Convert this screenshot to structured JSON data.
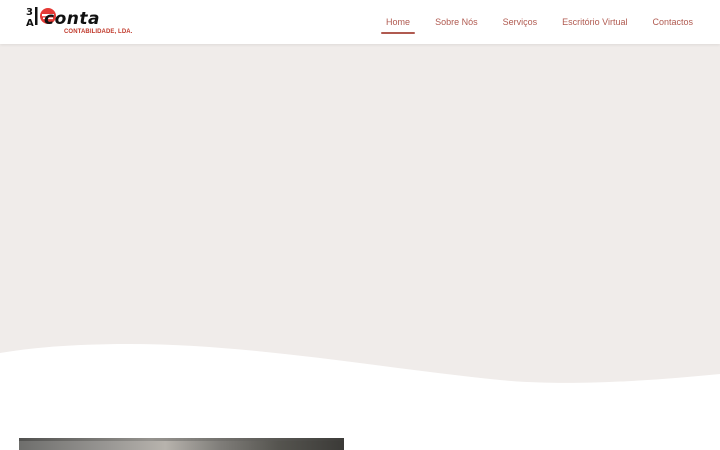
{
  "header": {
    "logo": {
      "wordmark": "conta",
      "subtitle": "CONTABILIDADE, LDA.",
      "mark_color": "#e53935"
    },
    "nav": {
      "items": [
        {
          "label": "Home",
          "active": true
        },
        {
          "label": "Sobre Nós",
          "active": false
        },
        {
          "label": "Serviços",
          "active": false
        },
        {
          "label": "Escritório Virtual",
          "active": false
        },
        {
          "label": "Contactos",
          "active": false
        }
      ],
      "color": "#b05a50"
    }
  },
  "hero": {
    "background_color": "#f0ecea"
  }
}
